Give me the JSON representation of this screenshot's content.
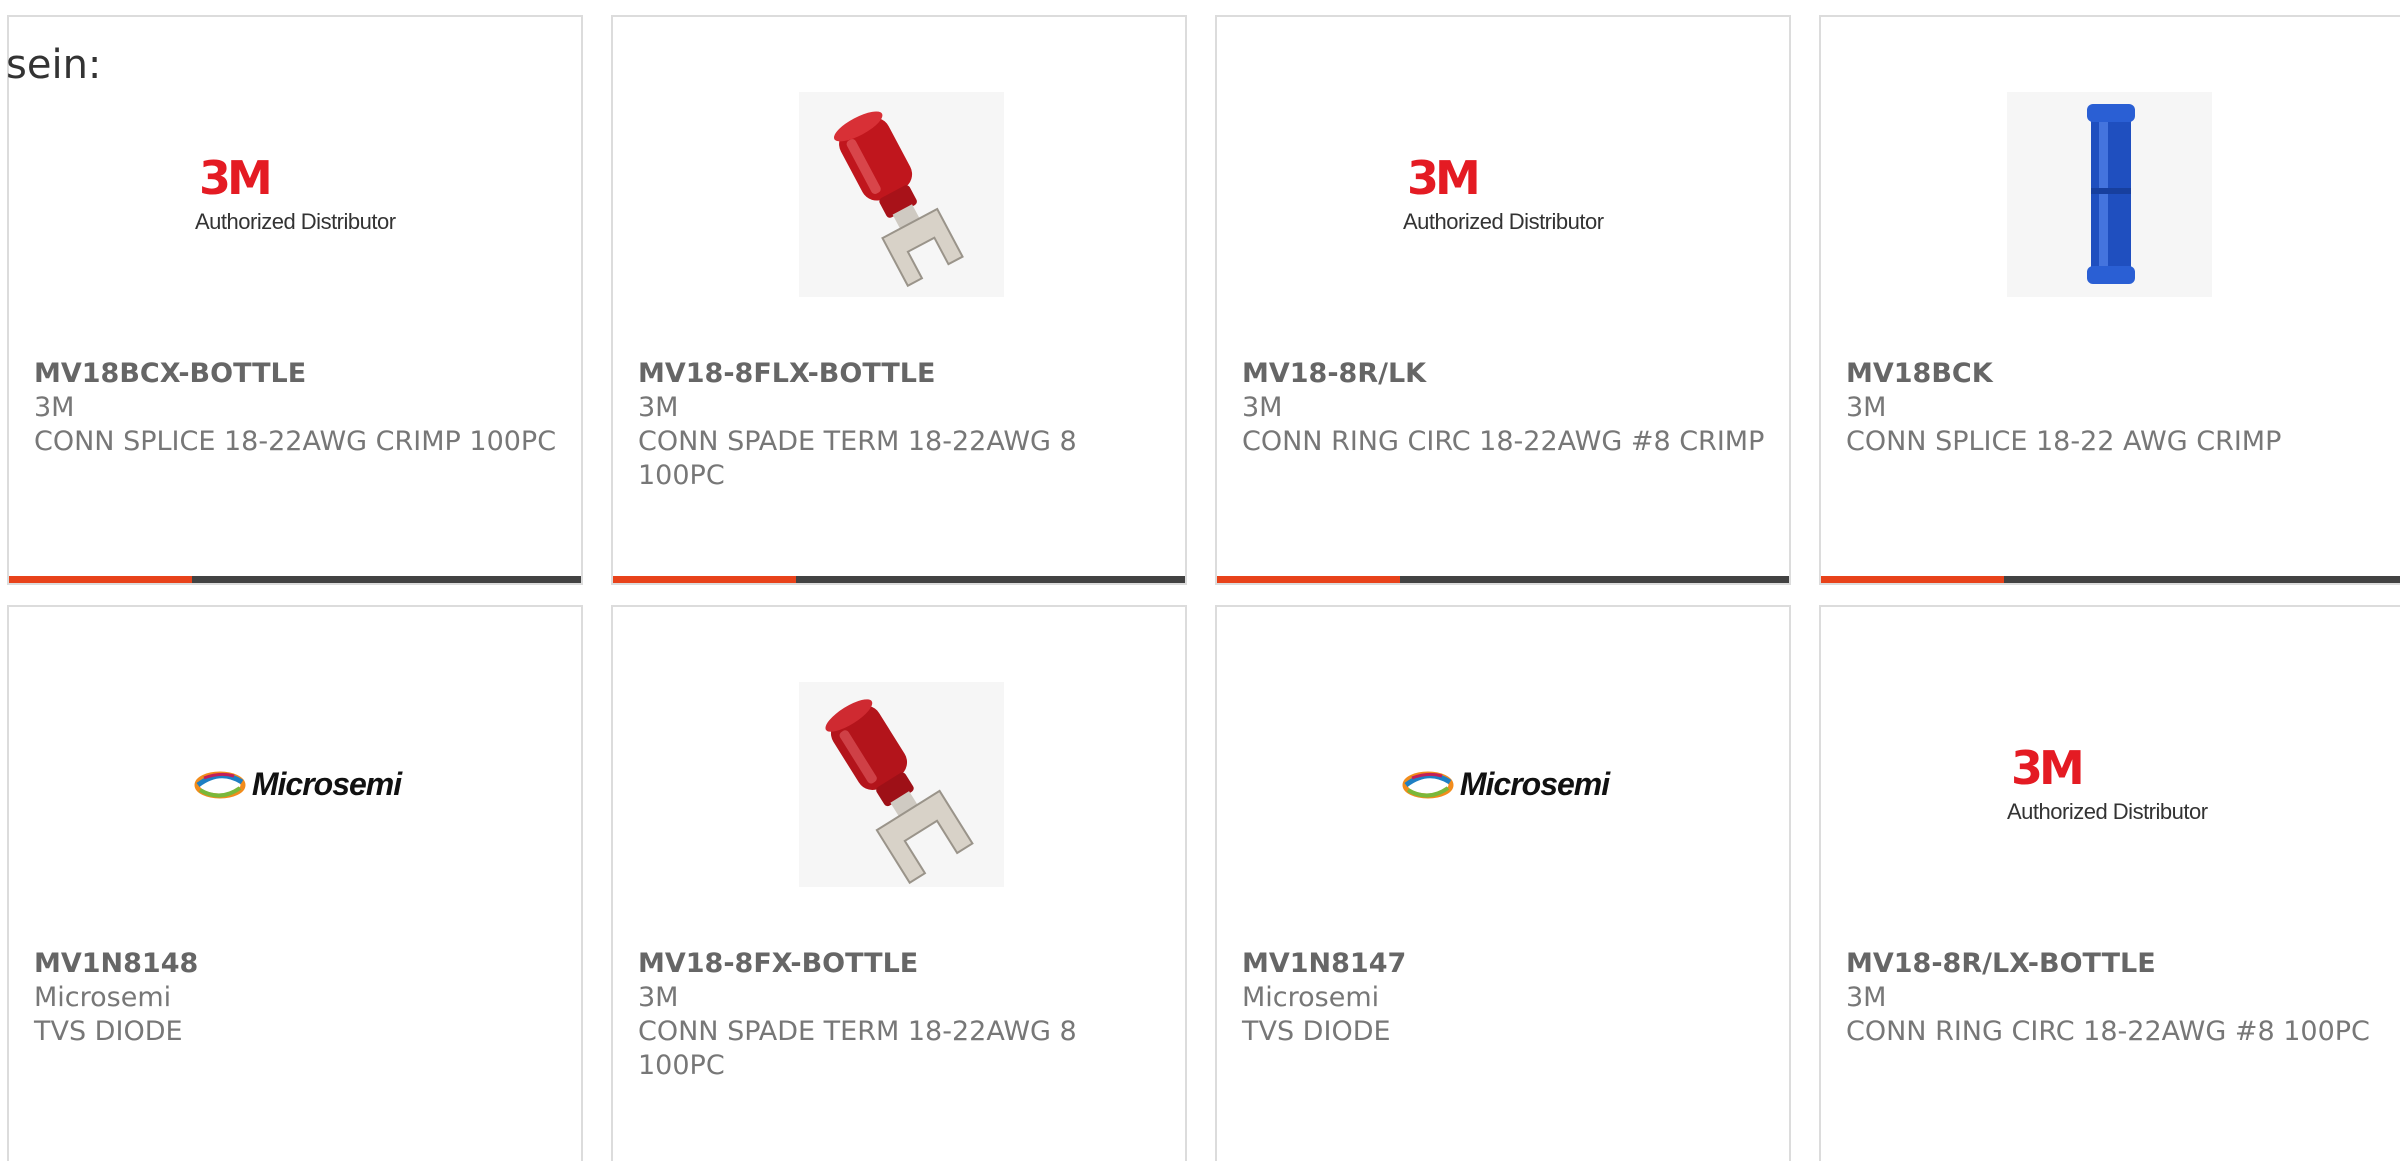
{
  "intro_text": "sein:",
  "colors": {
    "accent": "#e8421a",
    "bar": "#424242",
    "brand_3m": "#e41b23"
  },
  "products": [
    {
      "part_number": "MV18BCX-BOTTLE",
      "manufacturer": "3M",
      "description": "CONN SPLICE 18-22AWG CRIMP 100PC",
      "image": "3m-authorized-distributor-logo",
      "logo_mark": "3M",
      "logo_tagline": "Authorized Distributor"
    },
    {
      "part_number": "MV18-8FLX-BOTTLE",
      "manufacturer": "3M",
      "description": "CONN SPADE TERM 18-22AWG 8 100PC",
      "image": "red-spade-terminal-photo"
    },
    {
      "part_number": "MV18-8R/LK",
      "manufacturer": "3M",
      "description": "CONN RING CIRC 18-22AWG #8 CRIMP",
      "image": "3m-authorized-distributor-logo",
      "logo_mark": "3M",
      "logo_tagline": "Authorized Distributor"
    },
    {
      "part_number": "MV18BCK",
      "manufacturer": "3M",
      "description": "CONN SPLICE 18-22 AWG CRIMP",
      "image": "blue-butt-splice-photo"
    },
    {
      "part_number": "MV1N8148",
      "manufacturer": "Microsemi",
      "description": "TVS DIODE",
      "image": "microsemi-logo",
      "logo_mark": "Microsemi"
    },
    {
      "part_number": "MV18-8FX-BOTTLE",
      "manufacturer": "3M",
      "description": "CONN SPADE TERM 18-22AWG 8 100PC",
      "image": "red-spade-terminal-photo"
    },
    {
      "part_number": "MV1N8147",
      "manufacturer": "Microsemi",
      "description": "TVS DIODE",
      "image": "microsemi-logo",
      "logo_mark": "Microsemi"
    },
    {
      "part_number": "MV18-8R/LX-BOTTLE",
      "manufacturer": "3M",
      "description": "CONN RING CIRC 18-22AWG #8 100PC",
      "image": "3m-authorized-distributor-logo",
      "logo_mark": "3M",
      "logo_tagline": "Authorized Distributor"
    }
  ]
}
